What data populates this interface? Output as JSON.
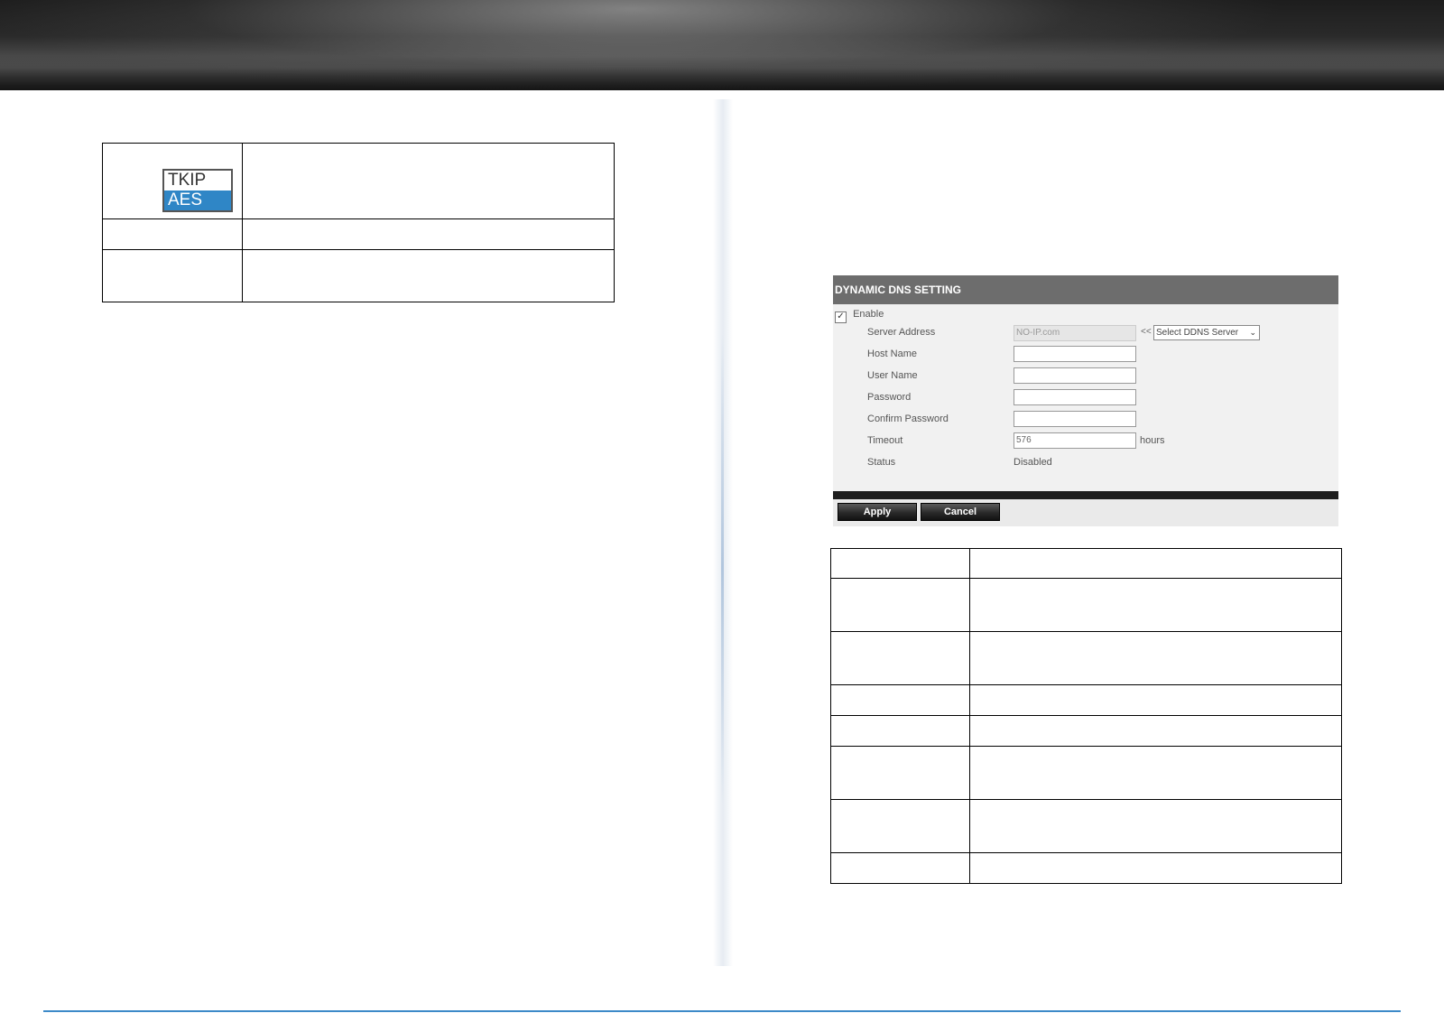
{
  "cipher_list": {
    "options": [
      "TKIP",
      "AES"
    ],
    "selected": "AES"
  },
  "ddns": {
    "header": "DYNAMIC DNS SETTING",
    "enable_label": "Enable",
    "enable_checked": true,
    "fields": {
      "server_address": {
        "label": "Server Address",
        "value": "NO-IP.com"
      },
      "host_name": {
        "label": "Host Name",
        "value": ""
      },
      "user_name": {
        "label": "User Name",
        "value": ""
      },
      "password": {
        "label": "Password",
        "value": ""
      },
      "confirm_password": {
        "label": "Confirm Password",
        "value": ""
      },
      "timeout": {
        "label": "Timeout",
        "value": "576",
        "unit": "hours"
      },
      "status": {
        "label": "Status",
        "value": "Disabled"
      }
    },
    "server_select": {
      "prefix": "<<",
      "selected": "Select DDNS Server"
    },
    "buttons": {
      "apply": "Apply",
      "cancel": "Cancel"
    }
  }
}
